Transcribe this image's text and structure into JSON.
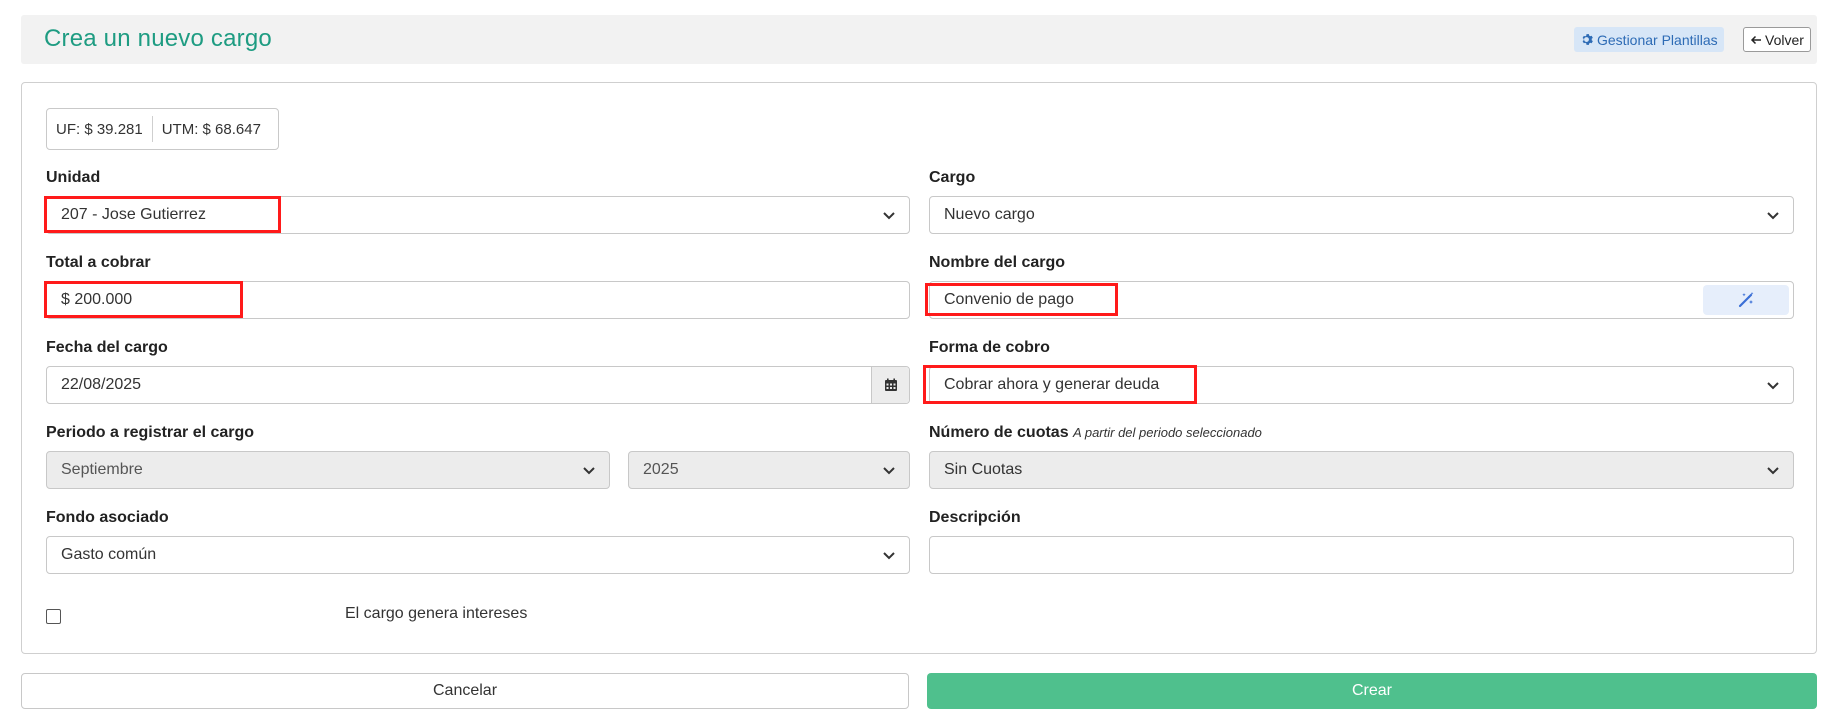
{
  "header": {
    "title": "Crea un nuevo cargo",
    "manage_templates_label": "Gestionar Plantillas",
    "back_label": "Volver"
  },
  "indicators": {
    "uf": "UF: $ 39.281",
    "utm": "UTM: $ 68.647"
  },
  "form": {
    "unidad": {
      "label": "Unidad",
      "value": "207 - Jose Gutierrez"
    },
    "cargo": {
      "label": "Cargo",
      "value": "Nuevo cargo"
    },
    "total": {
      "label": "Total a cobrar",
      "value": "$ 200.000"
    },
    "nombre": {
      "label": "Nombre del cargo",
      "value": "Convenio de pago"
    },
    "fecha": {
      "label": "Fecha del cargo",
      "value": "22/08/2025"
    },
    "forma": {
      "label": "Forma de cobro",
      "value": "Cobrar ahora y generar deuda"
    },
    "periodo": {
      "label": "Periodo a registrar el cargo",
      "month": "Septiembre",
      "year": "2025"
    },
    "cuotas": {
      "label": "Número de cuotas",
      "hint": "A partir del periodo seleccionado",
      "value": "Sin Cuotas"
    },
    "fondo": {
      "label": "Fondo asociado",
      "value": "Gasto común"
    },
    "descripcion": {
      "label": "Descripción",
      "value": ""
    },
    "intereses": {
      "label": "El cargo genera intereses",
      "checked": false
    }
  },
  "actions": {
    "cancel_label": "Cancelar",
    "create_label": "Crear"
  },
  "colors": {
    "brand": "#1e9c82",
    "create_button": "#4fc08d",
    "highlight": "#ff1a1a",
    "templates_button_bg": "#d7e6f7"
  },
  "icons": {
    "templates": "gear-icon",
    "back": "arrow-left-icon",
    "dropdown": "chevron-down-icon",
    "date": "calendar-icon",
    "generate": "magic-wand-icon"
  }
}
